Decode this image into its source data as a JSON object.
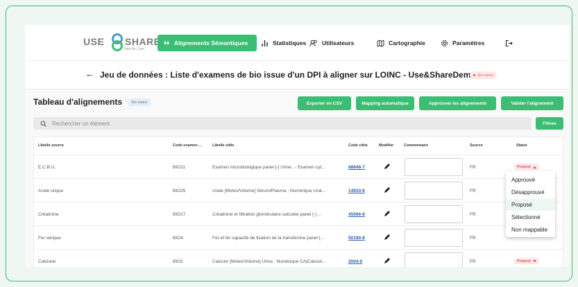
{
  "brand": {
    "use": "USE",
    "share": "SHARE",
    "tagline": "Data for Care"
  },
  "nav": {
    "items": [
      {
        "label": "Alignements Sémantiques",
        "icon": "align-icon",
        "active": true
      },
      {
        "label": "Statistiques",
        "icon": "bar-chart-icon"
      },
      {
        "label": "Utilisateurs",
        "icon": "users-icon"
      },
      {
        "label": "Cartographie",
        "icon": "map-icon"
      },
      {
        "label": "Paramètres",
        "icon": "gear-icon"
      }
    ],
    "logout_icon": "logout-icon"
  },
  "page": {
    "back_icon": "←",
    "title": "Jeu de données : Liste d'examens de bio issue d'un DPI à aligner sur LOINC - Use&ShareDemo",
    "status": "En cours"
  },
  "section": {
    "title": "Tableau d'alignements",
    "status": "En cours",
    "buttons": {
      "export": "Exporter en CSV",
      "auto": "Mapping automatique",
      "approve": "Approuver les alignements",
      "validate": "Valider l'alignement"
    },
    "search_placeholder": "Rechercher un élément",
    "filters": "Filtres"
  },
  "table": {
    "headers": [
      "Libellé source",
      "Code examen ...",
      "Libellé cible",
      "Code cible",
      "Modifier",
      "Commentaire",
      "Source",
      "Statut"
    ],
    "rows": [
      {
        "source": "E.C.B.U.",
        "code": "BIO11",
        "target": "Examen microbiologique panel [-] Urine ; - Examen cyt...",
        "target_code": "88848-7",
        "comment": "",
        "origin": "FR",
        "status": "Proposé"
      },
      {
        "source": "Acide urique",
        "code": "BIO25",
        "target": "Urate [Moles/Volume] Sérum/Plasma ; Numérique Urat...",
        "target_code": "14933-6",
        "comment": "",
        "origin": "FR",
        "status": ""
      },
      {
        "source": "Créatinine",
        "code": "BIO17",
        "target": "Créatinine et filtration glomérulaire calculée panel [-] ...",
        "target_code": "45066-8",
        "comment": "",
        "origin": "FR",
        "status": ""
      },
      {
        "source": "Fer sérique",
        "code": "BIO4",
        "target": "Fer et fer capacité de fixation de la transferrine panel [...",
        "target_code": "50190-8",
        "comment": "",
        "origin": "FR",
        "status": ""
      },
      {
        "source": "Calciurie",
        "code": "BIO2",
        "target": "Calcium [Moles/Volume] Urine ; Numérique CA|Calciuri...",
        "target_code": "2004-0",
        "comment": "",
        "origin": "FR",
        "status": "Proposé"
      }
    ]
  },
  "dropdown": {
    "options": [
      "Approuvé",
      "Désapprouvé",
      "Proposé",
      "Sélectionné",
      "Non mappable"
    ],
    "selected": "Proposé"
  },
  "colors": {
    "accent": "#3bbd74",
    "frame": "#49b37a",
    "status_red": "#e65050",
    "link": "#2a5db0"
  }
}
